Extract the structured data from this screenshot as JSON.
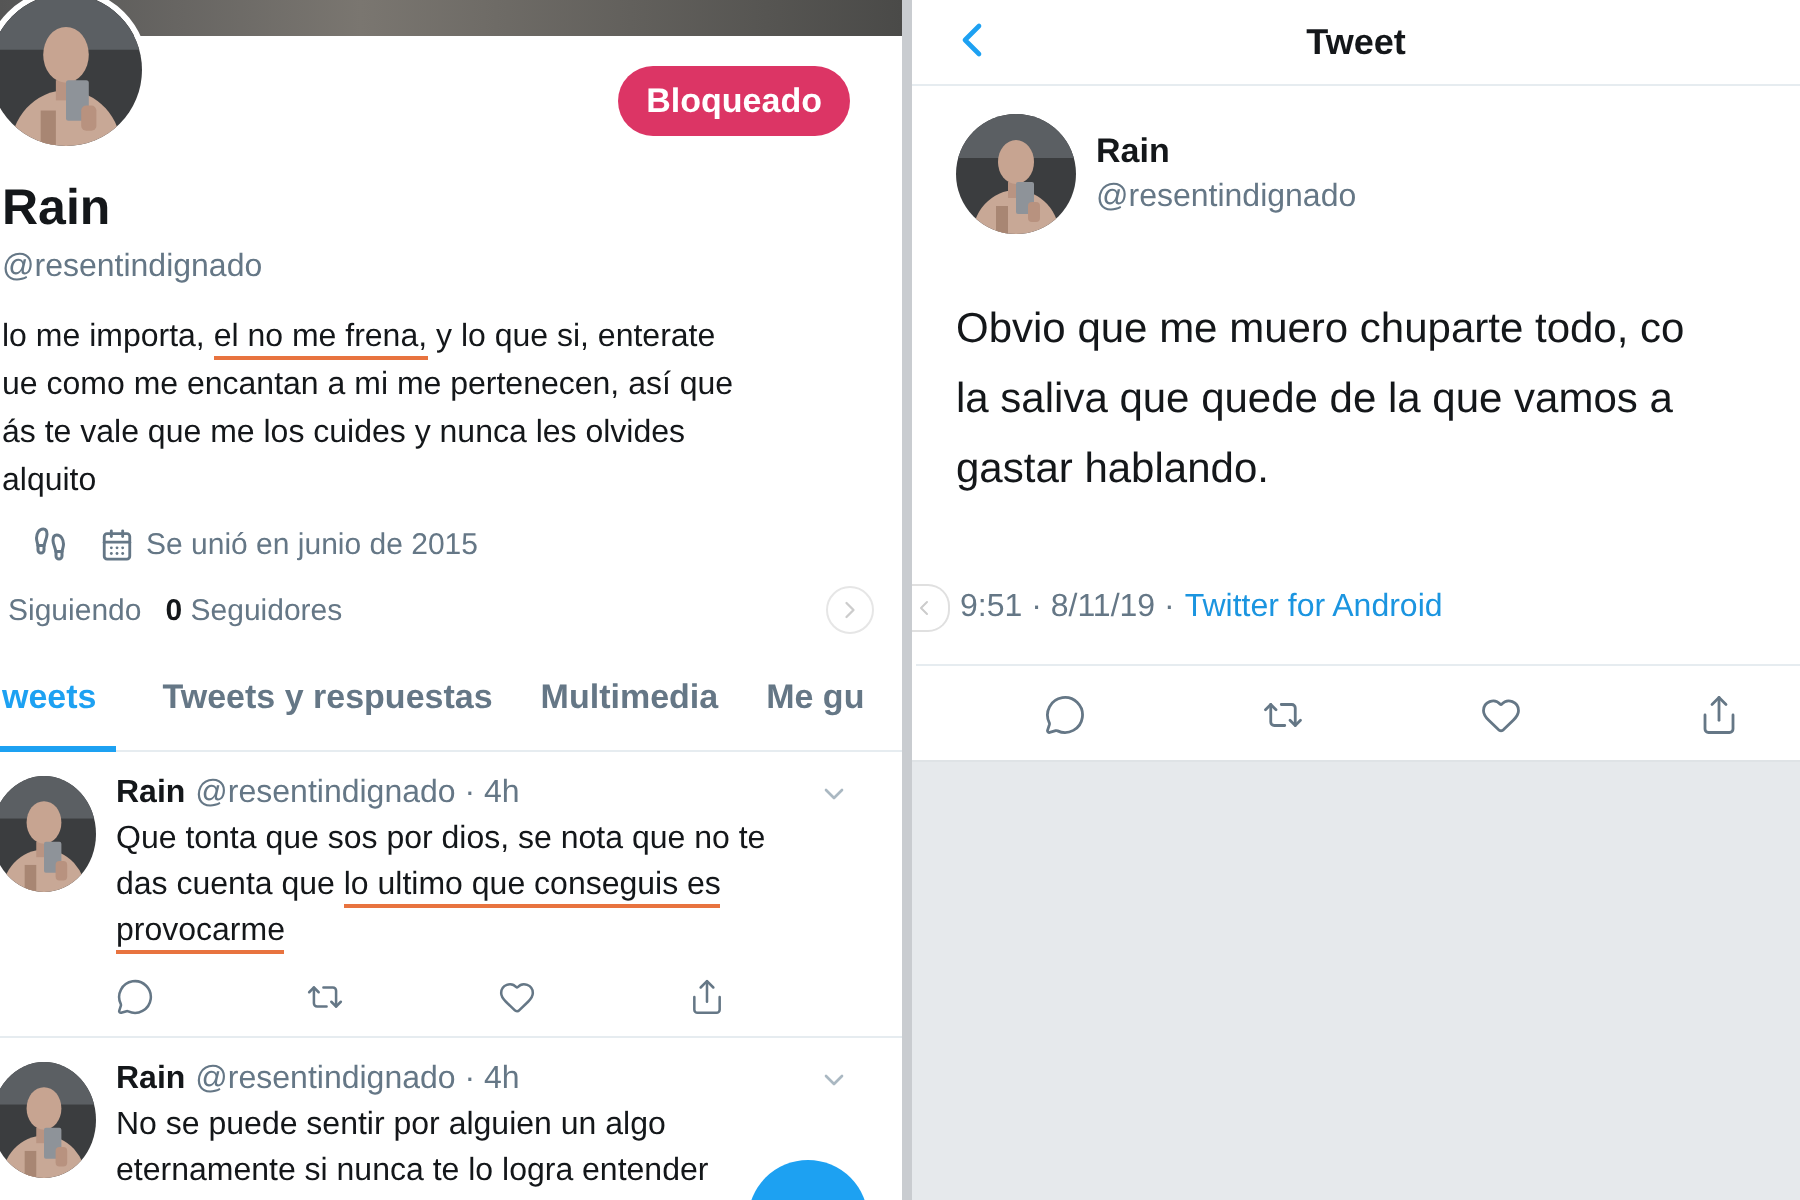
{
  "profile": {
    "block_button": "Bloqueado",
    "name": "Rain",
    "handle": "@resentindignado",
    "bio": [
      {
        "text": "lo me importa, ",
        "underlined": false
      },
      {
        "text": "el no me frena,",
        "underlined": true
      },
      {
        "text": " y lo que si, enterate\nue como me encantan a mi me pertenecen, así que\nás te vale que me los cuides y nunca les olvides\nalquito",
        "underlined": false
      }
    ],
    "joined": "Se unió en junio de 2015",
    "following_label": "Siguiendo",
    "followers_count": "0",
    "followers_label": "Seguidores"
  },
  "tabs": [
    {
      "label": "weets",
      "selected": true
    },
    {
      "label": "Tweets y respuestas",
      "selected": false
    },
    {
      "label": "Multimedia",
      "selected": false
    },
    {
      "label": "Me gu",
      "selected": false
    }
  ],
  "tweets": [
    {
      "name": "Rain",
      "handle": "@resentindignado",
      "time": "· 4h",
      "segments": [
        {
          "text": "Que tonta que sos por dios, se nota que no te\ndas cuenta que ",
          "underlined": false
        },
        {
          "text": "lo ultimo que conseguis es\nprovocarme",
          "underlined": true
        }
      ]
    },
    {
      "name": "Rain",
      "handle": "@resentindignado",
      "time": "· 4h",
      "segments": [
        {
          "text": "No se puede sentir por alguien un algo\neternamente si nunca te lo logra entender",
          "underlined": false
        }
      ]
    }
  ],
  "detail": {
    "title": "Tweet",
    "name": "Rain",
    "handle": "@resentindignado",
    "text": "Obvio que me muero chuparte todo, co\nla saliva que quede de la que vamos a\ngastar hablando.",
    "time": "9:51 · 8/11/19 ·",
    "source": "Twitter for Android"
  }
}
